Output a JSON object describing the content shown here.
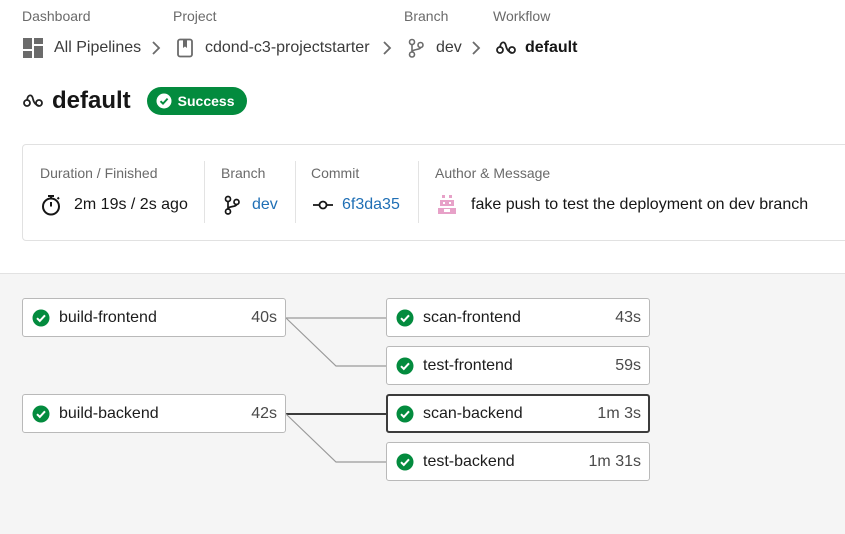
{
  "breadcrumb": {
    "dashboard_label": "Dashboard",
    "project_label": "Project",
    "branch_label": "Branch",
    "workflow_label": "Workflow",
    "all_pipelines": "All Pipelines",
    "project_name": "cdond-c3-projectstarter",
    "branch_name": "dev",
    "workflow_name": "default"
  },
  "workflow": {
    "title": "default",
    "status": "Success"
  },
  "summary": {
    "duration_label": "Duration / Finished",
    "duration_value": "2m 19s / 2s ago",
    "branch_label": "Branch",
    "branch_value": "dev",
    "commit_label": "Commit",
    "commit_value": "6f3da35",
    "author_label": "Author & Message",
    "message": "fake push to test the deployment on dev branch"
  },
  "jobs": [
    {
      "name": "build-frontend",
      "duration": "40s",
      "status": "success"
    },
    {
      "name": "scan-frontend",
      "duration": "43s",
      "status": "success"
    },
    {
      "name": "test-frontend",
      "duration": "59s",
      "status": "success"
    },
    {
      "name": "build-backend",
      "duration": "42s",
      "status": "success"
    },
    {
      "name": "scan-backend",
      "duration": "1m 3s",
      "status": "success"
    },
    {
      "name": "test-backend",
      "duration": "1m 31s",
      "status": "success"
    }
  ],
  "colors": {
    "success": "#038b3e",
    "link": "#1f6fb5"
  }
}
